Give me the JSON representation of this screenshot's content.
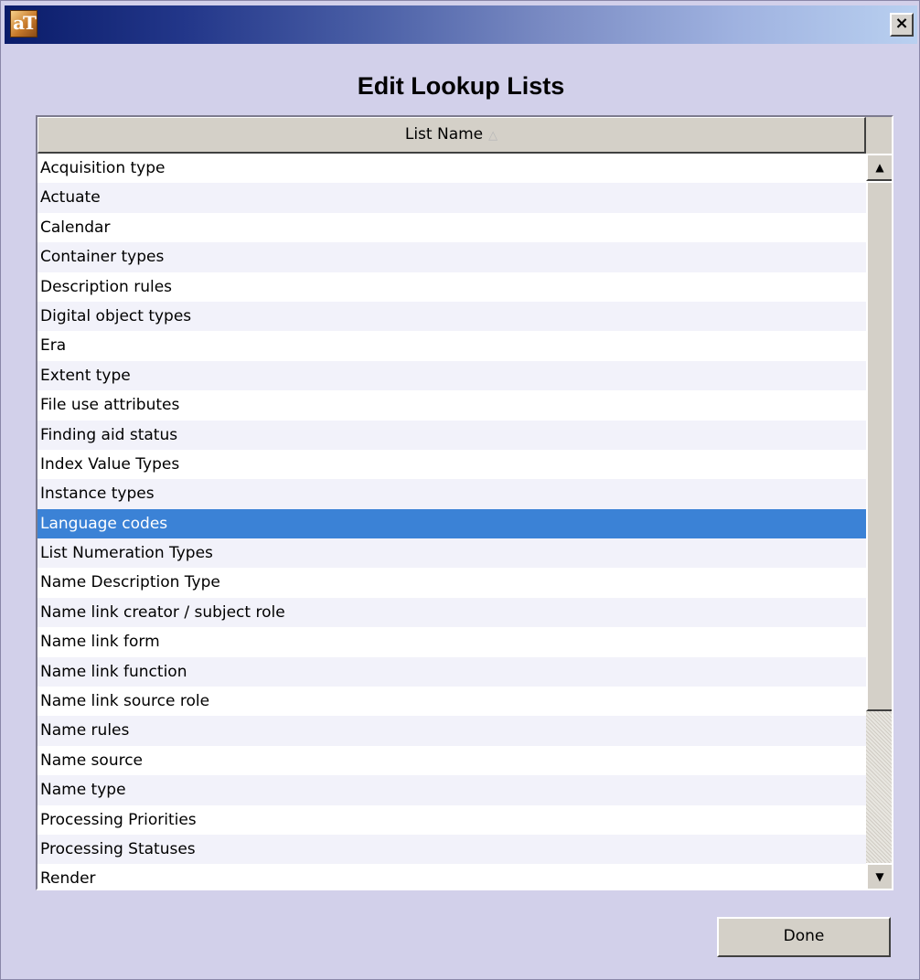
{
  "window": {
    "app_icon_text": "aT",
    "close_glyph": "×"
  },
  "dialog": {
    "title": "Edit Lookup Lists"
  },
  "table": {
    "header_label": "List Name",
    "sort_indicator": "△",
    "selected_index": 12,
    "rows": [
      "Acquisition type",
      "Actuate",
      "Calendar",
      "Container types",
      "Description rules",
      "Digital object types",
      "Era",
      "Extent type",
      "File use attributes",
      "Finding aid status",
      "Index Value Types",
      "Instance types",
      "Language codes",
      "List Numeration Types",
      "Name Description Type",
      "Name link creator / subject role",
      "Name link form",
      "Name link function",
      "Name link source role",
      "Name rules",
      "Name source",
      "Name type",
      "Processing Priorities",
      "Processing Statuses",
      "Render"
    ]
  },
  "scrollbar": {
    "up_glyph": "▲",
    "down_glyph": "▼"
  },
  "footer": {
    "done_label": "Done"
  },
  "colors": {
    "selection": "#3b82d6",
    "dialog_background": "#d2d0ea",
    "title_gradient_start": "#0a1c6a",
    "title_gradient_end": "#b9d0f0"
  }
}
